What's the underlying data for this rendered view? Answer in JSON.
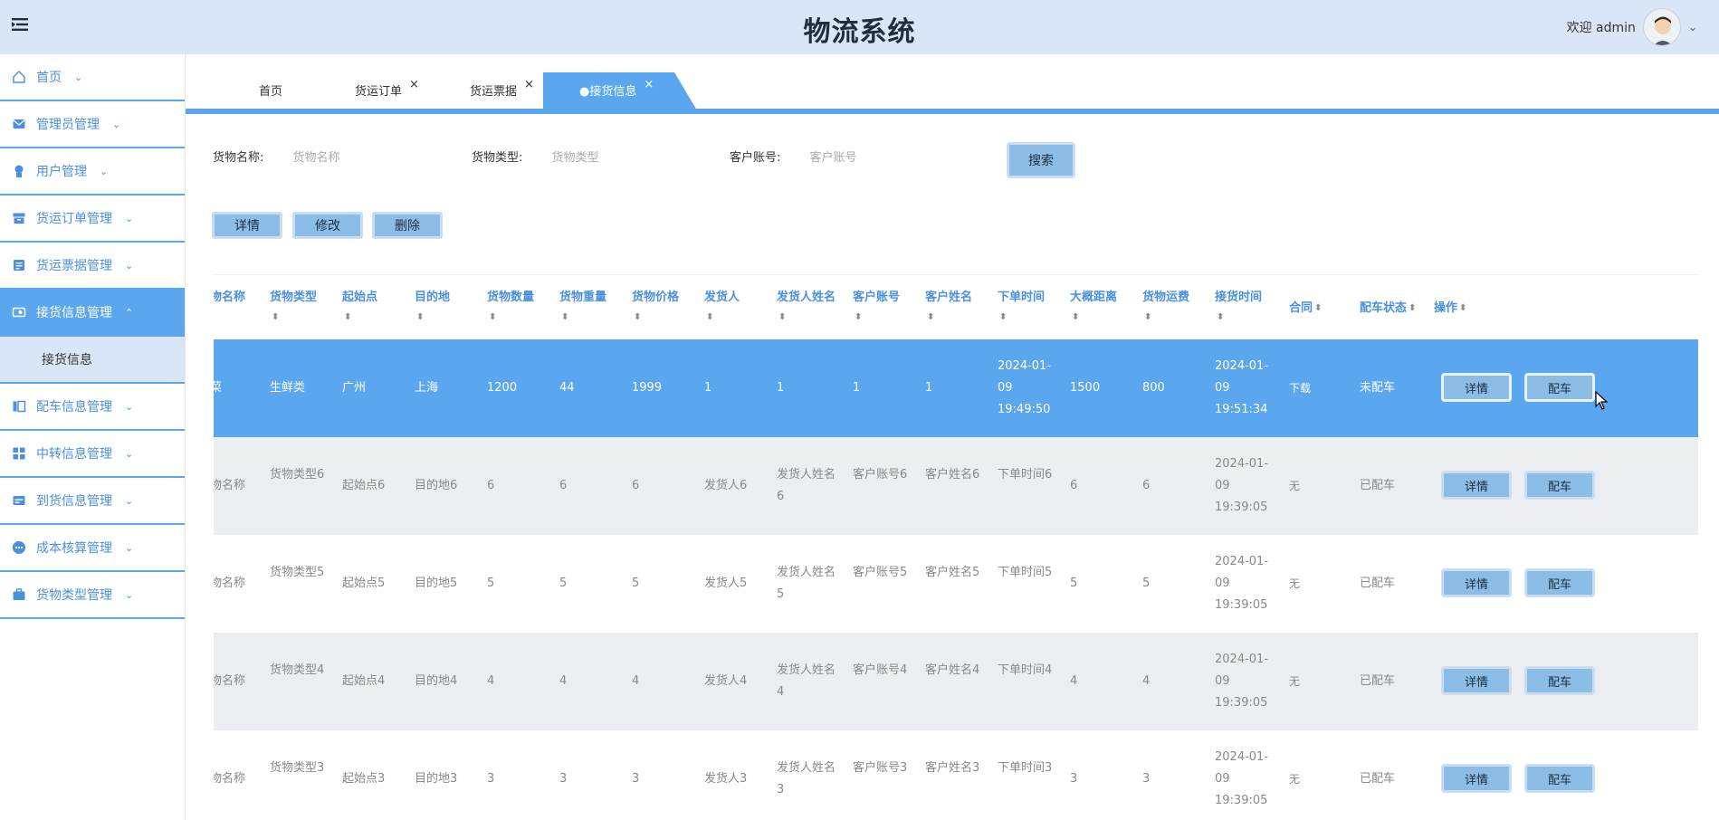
{
  "app_title": "物流系统",
  "user": {
    "welcome": "欢迎 admin"
  },
  "sidebar": {
    "items": [
      {
        "label": "首页",
        "icon": "home-icon"
      },
      {
        "label": "管理员管理",
        "icon": "envelope-icon"
      },
      {
        "label": "用户管理",
        "icon": "user-badge-icon"
      },
      {
        "label": "货运订单管理",
        "icon": "archive-icon"
      },
      {
        "label": "货运票据管理",
        "icon": "ticket-icon"
      },
      {
        "label": "接货信息管理",
        "icon": "receive-icon",
        "active": true
      },
      {
        "label": "配车信息管理",
        "icon": "columns-icon"
      },
      {
        "label": "中转信息管理",
        "icon": "grid-icon"
      },
      {
        "label": "到货信息管理",
        "icon": "wallet-icon"
      },
      {
        "label": "成本核算管理",
        "icon": "dots-icon"
      },
      {
        "label": "货物类型管理",
        "icon": "briefcase-icon"
      }
    ],
    "sub_item": "接货信息"
  },
  "tabs": [
    {
      "label": "首页",
      "closable": false
    },
    {
      "label": "货运订单",
      "closable": true
    },
    {
      "label": "货运票据",
      "closable": true
    },
    {
      "label": "●接货信息",
      "closable": true,
      "active": true
    }
  ],
  "search": {
    "fields": [
      {
        "label": "货物名称:",
        "placeholder": "货物名称"
      },
      {
        "label": "货物类型:",
        "placeholder": "货物类型"
      },
      {
        "label": "客户账号:",
        "placeholder": "客户账号"
      }
    ],
    "button": "搜索"
  },
  "actions": {
    "detail": "详情",
    "edit": "修改",
    "delete": "删除"
  },
  "table": {
    "headers": [
      "物名称",
      "货物类型",
      "起始点",
      "目的地",
      "货物数量",
      "货物重量",
      "货物价格",
      "发货人",
      "发货人姓名",
      "客户账号",
      "客户姓名",
      "下单时间",
      "大概距离",
      "货物运费",
      "接货时间",
      "合同",
      "配车状态",
      "操作"
    ],
    "rows": [
      {
        "cells": [
          "菜",
          "生鲜类",
          "广州",
          "上海",
          "1200",
          "44",
          "1999",
          "1",
          "1",
          "1",
          "1",
          "2024-01-09 19:49:50",
          "1500",
          "800",
          "2024-01-09 19:51:34",
          "下载",
          "未配车"
        ],
        "detail": "详情",
        "assign": "配车"
      },
      {
        "cells": [
          "物名称",
          "货物类型6",
          "起始点6",
          "目的地6",
          "6",
          "6",
          "6",
          "发货人6",
          "发货人姓名6",
          "客户账号6",
          "客户姓名6",
          "下单时间6",
          "6",
          "6",
          "2024-01-09 19:39:05",
          "无",
          "已配车"
        ],
        "detail": "详情",
        "assign": "配车"
      },
      {
        "cells": [
          "物名称",
          "货物类型5",
          "起始点5",
          "目的地5",
          "5",
          "5",
          "5",
          "发货人5",
          "发货人姓名5",
          "客户账号5",
          "客户姓名5",
          "下单时间5",
          "5",
          "5",
          "2024-01-09 19:39:05",
          "无",
          "已配车"
        ],
        "detail": "详情",
        "assign": "配车"
      },
      {
        "cells": [
          "物名称",
          "货物类型4",
          "起始点4",
          "目的地4",
          "4",
          "4",
          "4",
          "发货人4",
          "发货人姓名4",
          "客户账号4",
          "客户姓名4",
          "下单时间4",
          "4",
          "4",
          "2024-01-09 19:39:05",
          "无",
          "已配车"
        ],
        "detail": "详情",
        "assign": "配车"
      },
      {
        "cells": [
          "物名称",
          "货物类型3",
          "起始点3",
          "目的地3",
          "3",
          "3",
          "3",
          "发货人3",
          "发货人姓名3",
          "客户账号3",
          "客户姓名3",
          "下单时间3",
          "3",
          "3",
          "2024-01-09 19:39:05",
          "无",
          "已配车"
        ],
        "detail": "详情",
        "assign": "配车"
      }
    ]
  },
  "colors": {
    "primary": "#5aa7ef",
    "header_bg": "#d9e6f7",
    "button": "#8bbde6",
    "row_alt": "#eceef1",
    "link": "#2f88ff"
  }
}
